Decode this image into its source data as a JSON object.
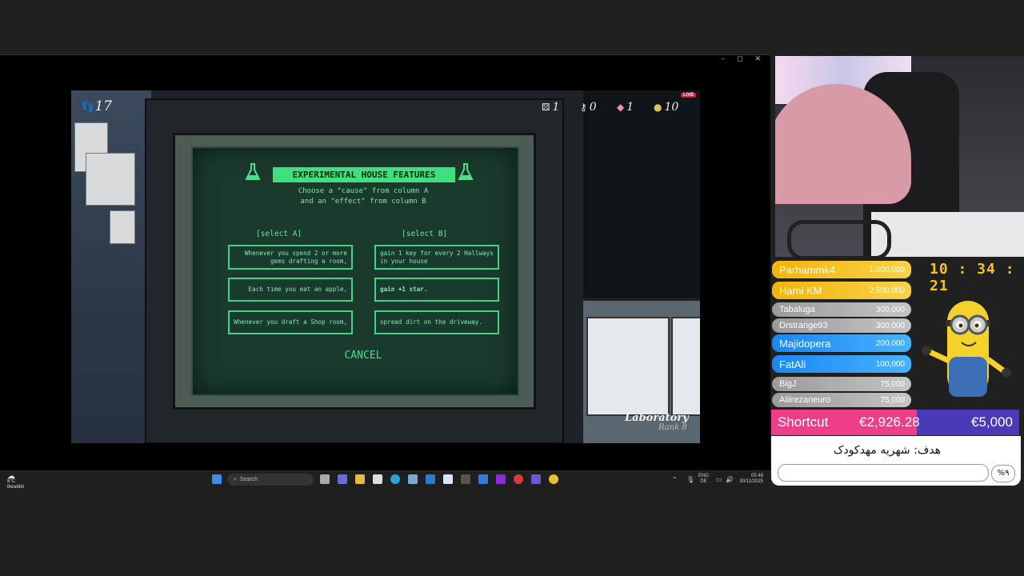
{
  "window": {
    "controls": "– ◻ ✕"
  },
  "hud": {
    "steps": "17",
    "dice": "1",
    "keys": "0",
    "gems": "1",
    "coins": "10",
    "live_badge": "LIVE"
  },
  "dialog": {
    "title": "EXPERIMENTAL HOUSE FEATURES",
    "instruction_line1": "Choose a \"cause\" from column A",
    "instruction_line2": "and an \"effect\" from column B",
    "column_a_header": "[select A]",
    "column_b_header": "[select B]",
    "column_a": [
      "Whenever you spend 2 or more gems drafting a room,",
      "Each time you eat an apple,",
      "Whenever you draft a Shop room,"
    ],
    "column_b": [
      "gain 1 key for every 2 Hallways in your house",
      "gain +1 star.",
      "spread dirt on the driveway."
    ],
    "cancel_label": "CANCEL"
  },
  "room": {
    "name": "Laboratory",
    "rank": "Rank 8"
  },
  "taskbar": {
    "weather_temp": "8°C",
    "weather_desc": "Bewölkt",
    "search_placeholder": "Search",
    "lang": "ENG",
    "lang_region": "DE",
    "time": "05:48",
    "date": "30/11/2025"
  },
  "donations": [
    {
      "name": "Parhammk4",
      "amount": "1,000,000",
      "tier": "gold"
    },
    {
      "name": "Hami KM",
      "amount": "2,500,000",
      "tier": "gold"
    },
    {
      "name": "Tabaluga",
      "amount": "300,000",
      "tier": "grey"
    },
    {
      "name": "Drstrange93",
      "amount": "300,000",
      "tier": "grey"
    },
    {
      "name": "Majidopera",
      "amount": "200,000",
      "tier": "blue"
    },
    {
      "name": "FatAli",
      "amount": "100,000",
      "tier": "blue"
    },
    {
      "name": "BigJ",
      "amount": "75,000",
      "tier": "grey"
    },
    {
      "name": "Aliirezaneuro",
      "amount": "75,000",
      "tier": "grey"
    }
  ],
  "clock": "10 : 34 : 21",
  "goal": {
    "label": "Shortcut",
    "current": "€2,926.28",
    "target": "€5,000",
    "text": "هدف: شهریه مهدکودک",
    "percent": "%۹"
  },
  "colors": {
    "crt_green": "#3ee07e",
    "donation_gold": "#f2b40b",
    "donation_blue": "#1c86f2",
    "goal_pink": "#ef3d8a",
    "goal_purple": "#4a3ab8"
  }
}
